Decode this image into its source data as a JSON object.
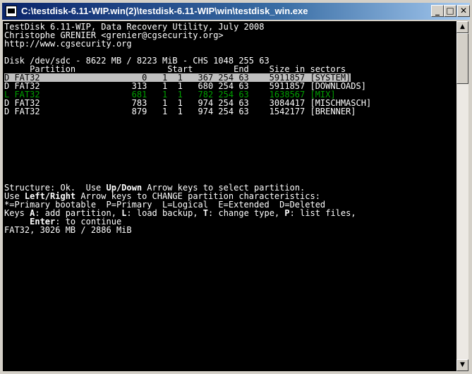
{
  "window": {
    "title": "C:\\testdisk-6.11-WIP.win(2)\\testdisk-6.11-WIP\\win\\testdisk_win.exe",
    "minimize_glyph": "_",
    "maximize_glyph": "□",
    "close_glyph": "✕"
  },
  "header": {
    "line1": "TestDisk 6.11-WIP, Data Recovery Utility, July 2008",
    "line2": "Christophe GRENIER <grenier@cgsecurity.org>",
    "line3": "http://www.cgsecurity.org"
  },
  "disk": {
    "info": "Disk /dev/sdc - 8622 MB / 8223 MiB - CHS 1048 255 63",
    "columns": "     Partition                  Start        End    Size in sectors"
  },
  "partitions": [
    {
      "text": "D FAT32                    0   1  1   367 254 63    5911857 [SYSTEM]",
      "style": "selected"
    },
    {
      "text": "D FAT32                  313   1  1   680 254 63    5911857 [DOWNLOADS]",
      "style": "normal"
    },
    {
      "text": "L FAT32                  681   1  1   782 254 63    1638567 [MIX]",
      "style": "logical"
    },
    {
      "text": "D FAT32                  783   1  1   974 254 63    3084417 [MISCHMASCH]",
      "style": "normal"
    },
    {
      "text": "D FAT32                  879   1  1   974 254 63    1542177 [BRENNER]",
      "style": "normal"
    }
  ],
  "help": {
    "l1_a": "Structure: Ok.  Use ",
    "l1_b": "Up/Down",
    "l1_c": " Arrow keys to select partition.",
    "l2_a": "Use ",
    "l2_b": "Left/Right",
    "l2_c": " Arrow keys to CHANGE partition characteristics:",
    "l3": "*=Primary bootable  P=Primary  L=Logical  E=Extended  D=Deleted",
    "l4_a": "Keys ",
    "l4_b": "A",
    "l4_c": ": add partition, ",
    "l4_d": "L",
    "l4_e": ": load backup, ",
    "l4_f": "T",
    "l4_g": ": change type, ",
    "l4_h": "P",
    "l4_i": ": list files,",
    "l5_a": "     ",
    "l5_b": "Enter",
    "l5_c": ": to continue",
    "l6": "FAT32, 3026 MB / 2886 MiB"
  },
  "scrollbar": {
    "up_glyph": "▲",
    "down_glyph": "▼"
  }
}
